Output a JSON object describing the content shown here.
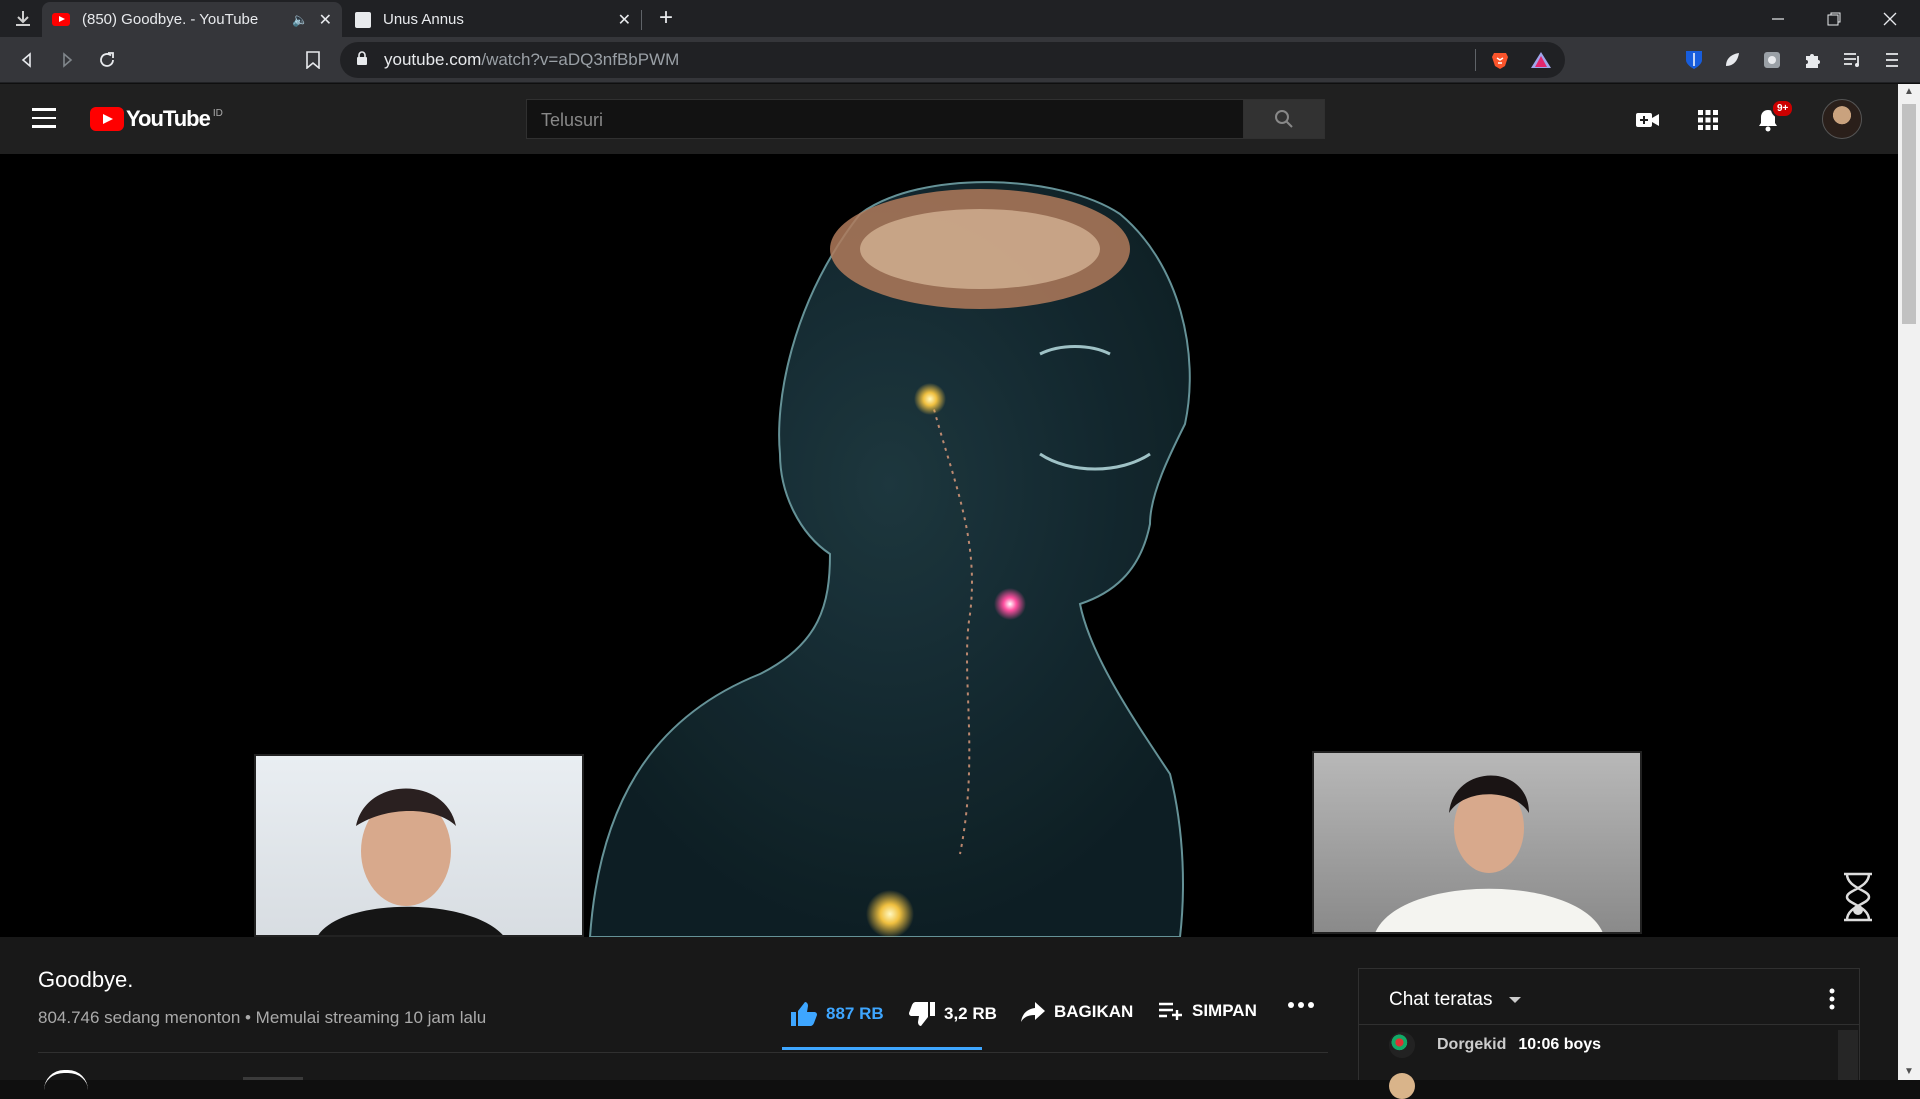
{
  "browser": {
    "tabs": [
      {
        "title": "(850) Goodbye. - YouTube",
        "active": true,
        "audio": true
      },
      {
        "title": "Unus Annus",
        "active": false
      }
    ],
    "url_host": "youtube.com",
    "url_path": "/watch?v=aDQ3nfBbPWM"
  },
  "youtube": {
    "logo_text": "YouTube",
    "country_code": "ID",
    "search_placeholder": "Telusuri",
    "notification_count": "9+"
  },
  "video": {
    "title": "Goodbye.",
    "meta": "804.746 sedang menonton • Memulai streaming 10 jam lalu",
    "like_count": "887 RB",
    "dislike_count": "3,2 RB",
    "share_label": "BAGIKAN",
    "save_label": "SIMPAN",
    "like_ratio": 0.996
  },
  "chat": {
    "title": "Chat teratas",
    "messages": [
      {
        "author": "Dorgekid",
        "text": "10:06 boys"
      }
    ]
  },
  "colors": {
    "accent": "#3ea6ff",
    "brand_red": "#ff0000",
    "background": "#181818"
  }
}
